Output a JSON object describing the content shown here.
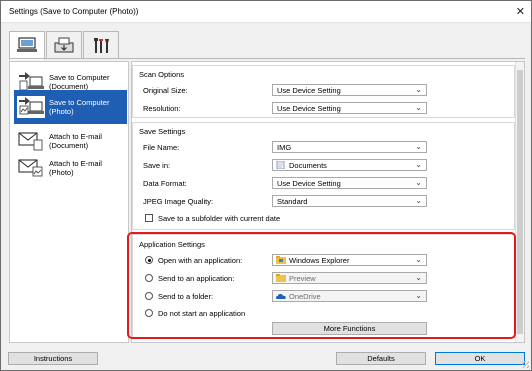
{
  "window": {
    "title": "Settings (Save to Computer (Photo))",
    "close_glyph": "✕"
  },
  "toptabs": [
    {
      "icon": "scan-from-computer-icon",
      "active": true
    },
    {
      "icon": "scan-from-operation-panel-icon",
      "active": false
    },
    {
      "icon": "general-settings-tools-icon",
      "active": false
    }
  ],
  "sidebar": {
    "items": [
      {
        "label": "Save to Computer (Document)",
        "icon": "save-document-icon",
        "active": false
      },
      {
        "label": "Save to Computer (Photo)",
        "icon": "save-photo-icon",
        "active": true
      },
      {
        "label": "Attach to E-mail (Document)",
        "icon": "email-document-icon",
        "active": false
      },
      {
        "label": "Attach to E-mail (Photo)",
        "icon": "email-photo-icon",
        "active": false
      }
    ]
  },
  "scan_options": {
    "title": "Scan Options",
    "original_size_label": "Original Size:",
    "original_size_value": "Use Device Setting",
    "resolution_label": "Resolution:",
    "resolution_value": "Use Device Setting"
  },
  "save_settings": {
    "title": "Save Settings",
    "file_name_label": "File Name:",
    "file_name_value": "IMG",
    "save_in_label": "Save in:",
    "save_in_value": "Documents",
    "data_format_label": "Data Format:",
    "data_format_value": "Use Device Setting",
    "jpeg_quality_label": "JPEG Image Quality:",
    "jpeg_quality_value": "Standard",
    "subfolder_label": "Save to a subfolder with current date"
  },
  "application_settings": {
    "title": "Application Settings",
    "open_with_label": "Open with an application:",
    "open_with_value": "Windows Explorer",
    "send_to_app_label": "Send to an application:",
    "send_to_app_value": "Preview",
    "send_to_folder_label": "Send to a folder:",
    "send_to_folder_value": "OneDrive",
    "do_not_start_label": "Do not start an application",
    "more_functions_label": "More Functions"
  },
  "footer": {
    "instructions_label": "Instructions",
    "defaults_label": "Defaults",
    "ok_label": "OK"
  },
  "colors": {
    "selection_blue": "#1e5fb4",
    "highlight_red": "#e21a1a"
  }
}
